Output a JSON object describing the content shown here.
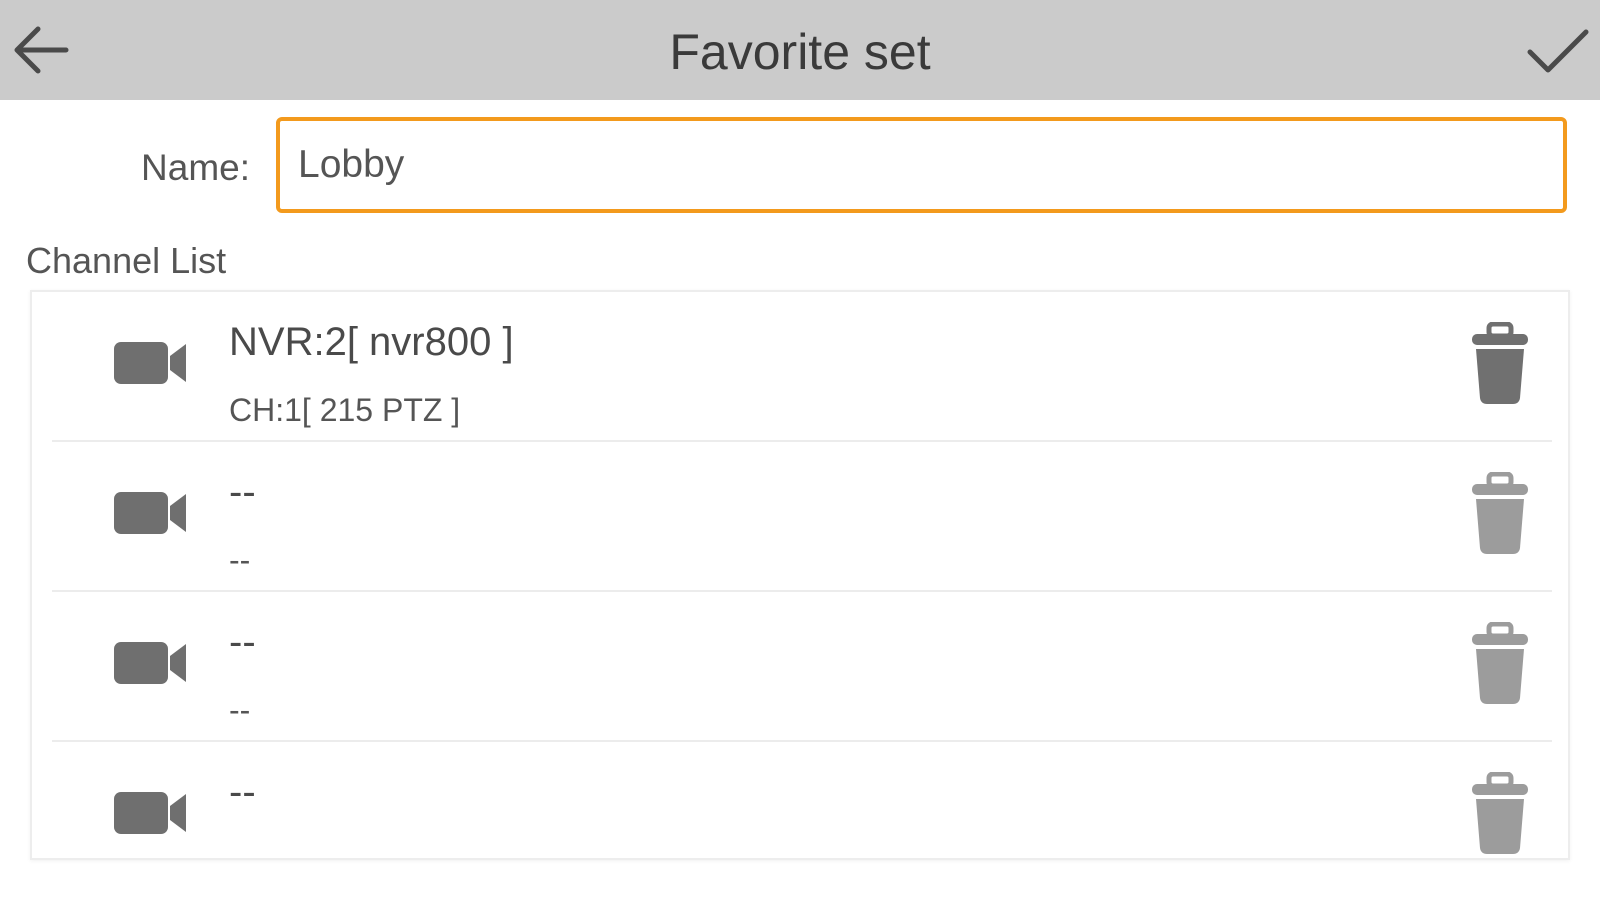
{
  "header": {
    "title": "Favorite set",
    "back_icon": "arrow-left-icon",
    "confirm_icon": "checkmark-icon",
    "background_color": "#cbcbcb"
  },
  "form": {
    "name_label": "Name:",
    "name_value": "Lobby",
    "input_border_color": "#f39a1d"
  },
  "channel_list": {
    "label": "Channel List",
    "items": [
      {
        "title": "NVR:2[ nvr800 ]",
        "subtitle": "CH:1[ 215 PTZ ]",
        "icon": "video-camera-icon",
        "delete_icon": "trash-icon",
        "active": true
      },
      {
        "title": "--",
        "subtitle": "--",
        "icon": "video-camera-icon",
        "delete_icon": "trash-icon",
        "active": false
      },
      {
        "title": "--",
        "subtitle": "--",
        "icon": "video-camera-icon",
        "delete_icon": "trash-icon",
        "active": false
      },
      {
        "title": "--",
        "subtitle": "",
        "icon": "video-camera-icon",
        "delete_icon": "trash-icon",
        "active": false
      }
    ]
  }
}
